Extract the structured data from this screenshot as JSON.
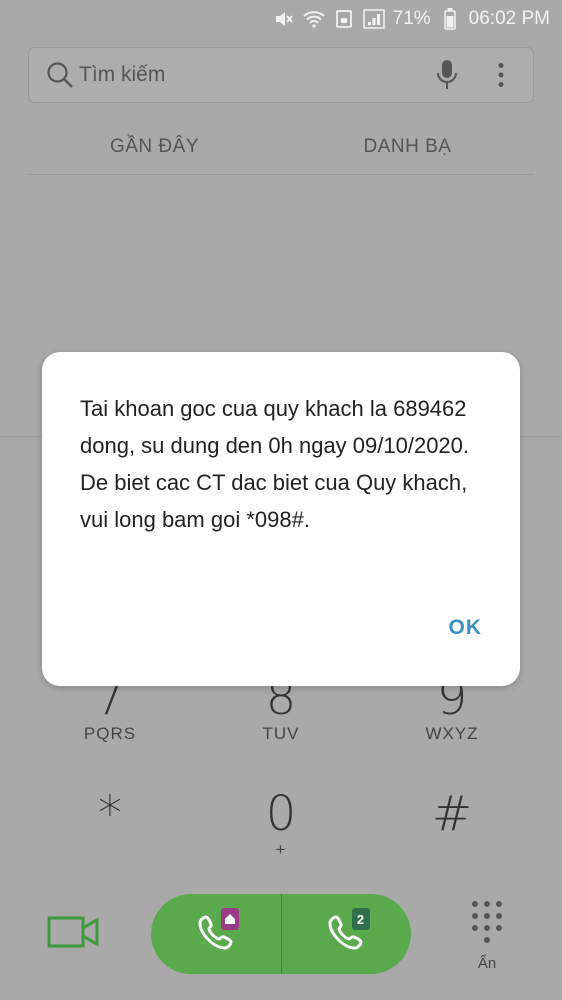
{
  "status_bar": {
    "battery": "71%",
    "time": "06:02 PM",
    "icons": [
      "mute-icon",
      "wifi-icon",
      "sim-icon",
      "signal-icon",
      "battery-icon"
    ]
  },
  "search": {
    "placeholder": "Tìm kiếm"
  },
  "tabs": [
    {
      "label": "GẦN ĐÂY"
    },
    {
      "label": "DANH BẠ"
    }
  ],
  "keypad": {
    "keys": [
      {
        "num": "7",
        "letters": "PQRS"
      },
      {
        "num": "8",
        "letters": "TUV"
      },
      {
        "num": "9",
        "letters": "WXYZ"
      },
      {
        "num": "*",
        "letters": ""
      },
      {
        "num": "0",
        "letters": "+"
      },
      {
        "num": "#",
        "letters": ""
      }
    ]
  },
  "bottom_bar": {
    "sim1_badge": "",
    "sim2_badge": "2",
    "hide_label": "Ẩn",
    "colors": {
      "call_green": "#5aa94d",
      "sim1_badge": "#9b3b86",
      "sim2_badge": "#2f6f4b"
    }
  },
  "dialog": {
    "message": "Tai khoan goc cua quy khach la 689462 dong, su dung den 0h ngay 09/10/2020. De biet cac CT dac biet cua Quy khach, vui long bam goi *098#.",
    "ok_label": "OK"
  }
}
